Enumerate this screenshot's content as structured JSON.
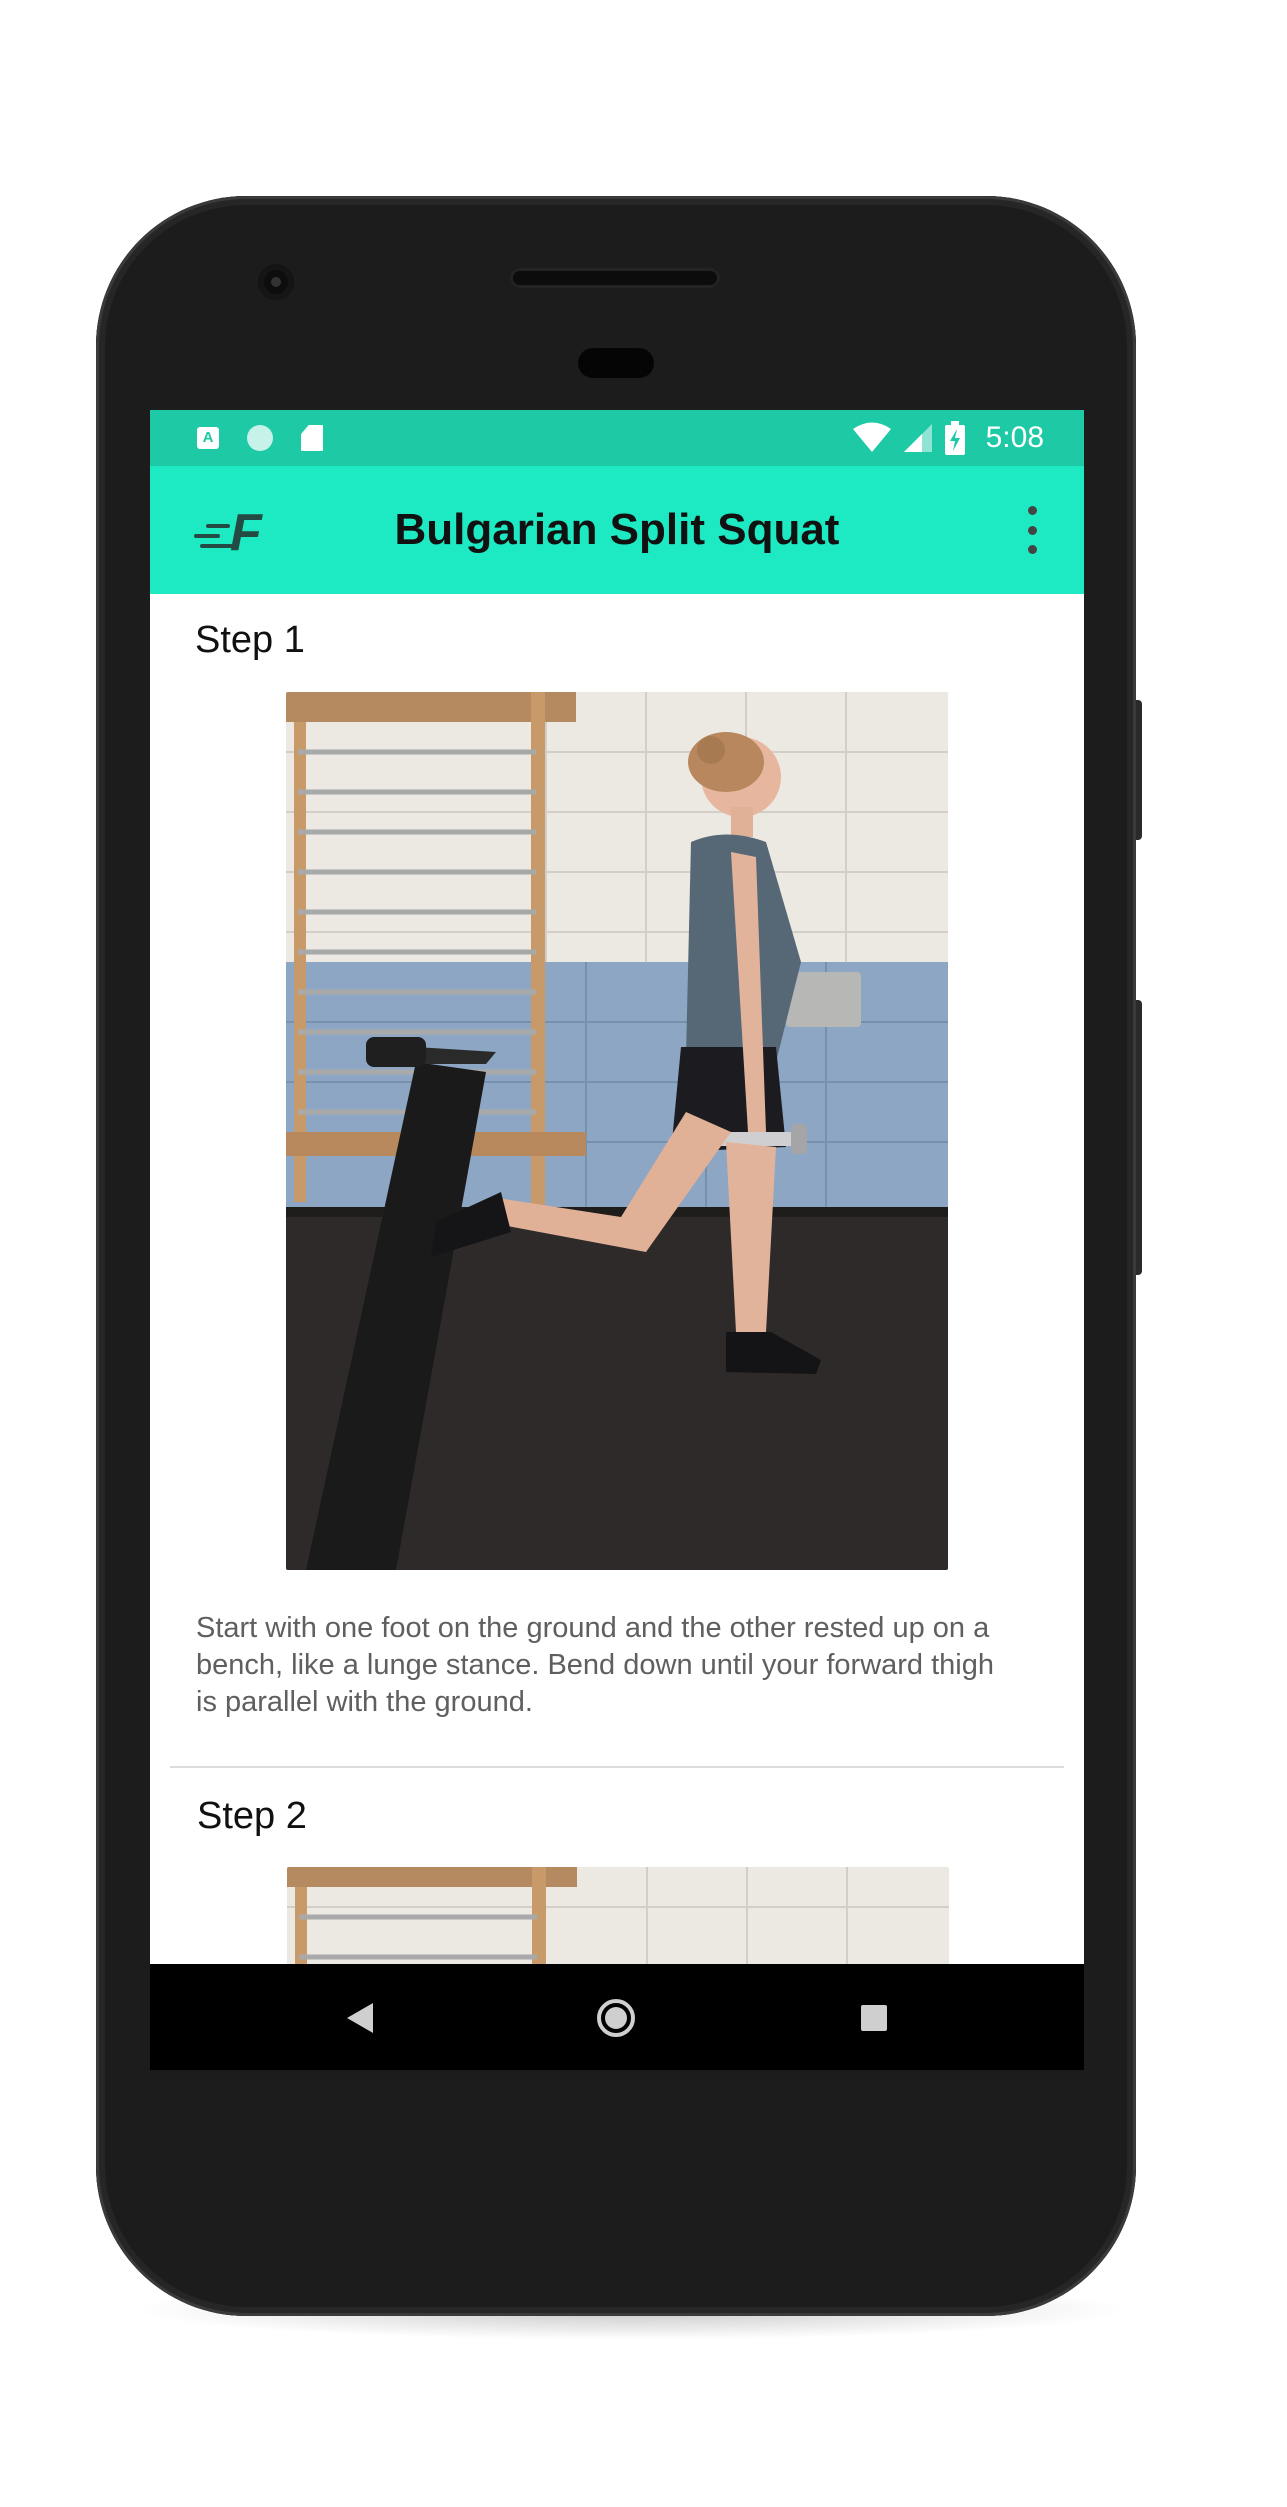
{
  "status_bar": {
    "time": "5:08",
    "left_icons": [
      "accessibility-a-icon",
      "sync-circle-icon",
      "sd-card-icon"
    ],
    "right_icons": [
      "wifi-icon",
      "cell-signal-icon",
      "battery-charging-icon"
    ]
  },
  "app_bar": {
    "title": "Bulgarian Split Squat",
    "logo_letter": "F",
    "menu_icon": "more-vert-icon",
    "background_color": "#1de9c2",
    "status_color": "#1ec9a6"
  },
  "steps": [
    {
      "heading": "Step 1",
      "description": "Start with one foot on the ground and the other rested up on a bench, like a lunge stance. Bend down until your forward thigh is parallel with the ground."
    },
    {
      "heading": "Step 2"
    }
  ],
  "nav_bar": {
    "buttons": [
      "back-triangle-icon",
      "home-circle-icon",
      "recents-square-icon"
    ]
  }
}
